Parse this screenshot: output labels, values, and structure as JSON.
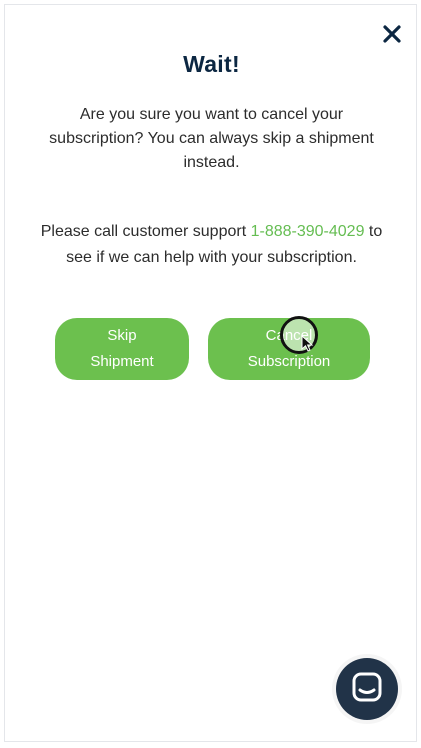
{
  "modal": {
    "title": "Wait!",
    "message": "Are you sure you want to cancel your subscription? You can always skip a shipment instead.",
    "support_prefix": "Please call customer support ",
    "support_phone": "1-888-390-4029",
    "support_suffix": " to see if we can help with your subscription.",
    "close_icon": "close-icon"
  },
  "buttons": {
    "skip_line1": "Skip",
    "skip_line2": "Shipment",
    "cancel_line1": "Cancel",
    "cancel_line2": "Subscription"
  },
  "chat": {
    "icon": "chat-icon"
  },
  "colors": {
    "button_green": "#6cc04e",
    "link_green": "#65bd52",
    "title_navy": "#0c2742",
    "chat_navy": "#213348"
  }
}
